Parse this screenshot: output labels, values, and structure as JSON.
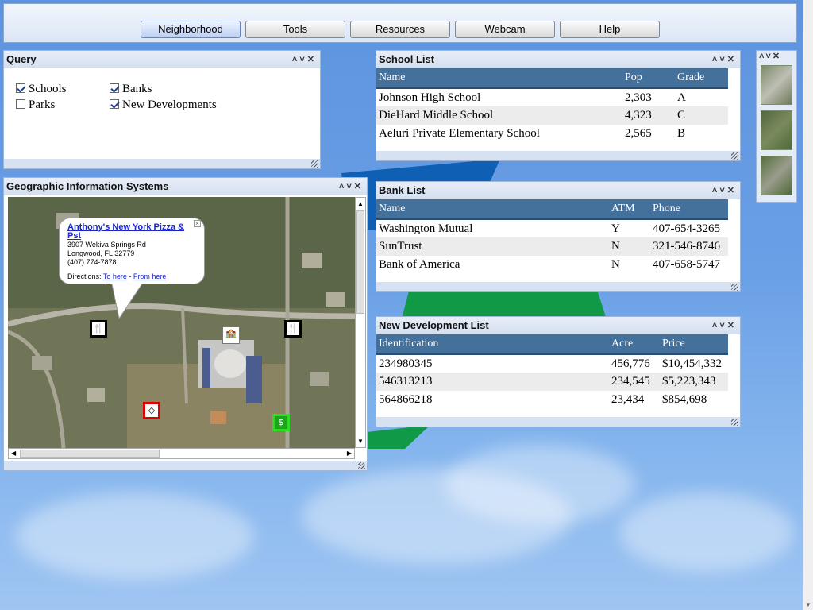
{
  "nav": {
    "buttons": [
      "Neighborhood",
      "Tools",
      "Resources",
      "Webcam",
      "Help"
    ],
    "active": "Neighborhood"
  },
  "query": {
    "title": "Query",
    "items": [
      {
        "label": "Schools",
        "checked": true
      },
      {
        "label": "Banks",
        "checked": true
      },
      {
        "label": "Parks",
        "checked": false
      },
      {
        "label": "New Developments",
        "checked": true
      }
    ]
  },
  "gis": {
    "title": "Geographic Information Systems",
    "popup": {
      "name": "Anthony's New York Pizza & Pst",
      "street": "3907 Wekiva Springs Rd",
      "city": "Longwood, FL 32779",
      "phone": "(407) 774-7878",
      "directions_label": "Directions:",
      "to_here": "To here",
      "separator": "-",
      "from_here": "From here"
    },
    "markers": [
      "restaurant-icon",
      "restaurant-icon",
      "school-icon",
      "park-icon",
      "bank-icon"
    ]
  },
  "school_list": {
    "title": "School List",
    "columns": [
      "Name",
      "Pop",
      "Grade"
    ],
    "rows": [
      [
        "Johnson High School",
        "2,303",
        "A"
      ],
      [
        "DieHard Middle School",
        "4,323",
        "C"
      ],
      [
        "Aeluri Private Elementary School",
        "2,565",
        "B"
      ]
    ]
  },
  "bank_list": {
    "title": "Bank List",
    "columns": [
      "Name",
      "ATM",
      "Phone"
    ],
    "rows": [
      [
        "Washington Mutual",
        "Y",
        "407-654-3265"
      ],
      [
        "SunTrust",
        "N",
        "321-546-8746"
      ],
      [
        "Bank of America",
        "N",
        "407-658-5747"
      ]
    ]
  },
  "development_list": {
    "title": "New Development List",
    "columns": [
      "Identification",
      "Acre",
      "Price"
    ],
    "rows": [
      [
        "234980345",
        "456,776",
        "$10,454,332"
      ],
      [
        "546313213",
        "234,545",
        "$5,223,343"
      ],
      [
        "564866218",
        "23,434",
        "$854,698"
      ]
    ]
  },
  "window_controls": {
    "up": "˄",
    "down": "˅",
    "close": "✕"
  },
  "colors": {
    "header_blue": "#44709c",
    "background": "#6aa0e6",
    "stripe_blue": "#0f5fb5",
    "stripe_green": "#109a48"
  }
}
